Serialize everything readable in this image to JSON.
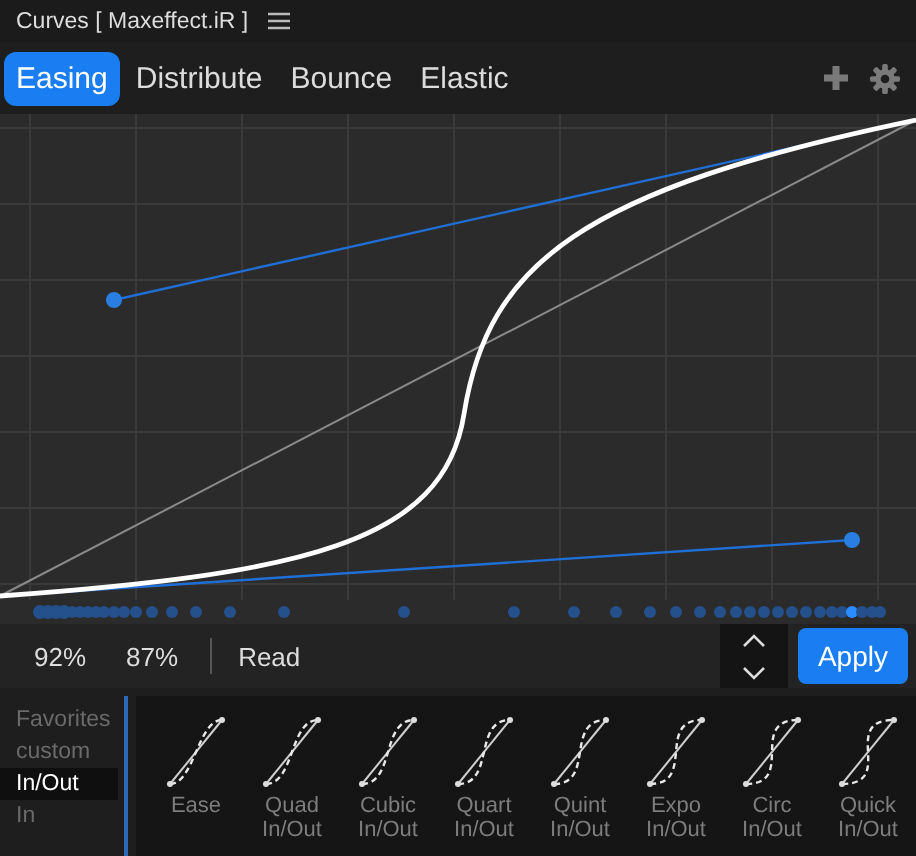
{
  "window": {
    "title": "Curves [ Maxeffect.iR ]"
  },
  "tabs": [
    {
      "label": "Easing",
      "selected": true
    },
    {
      "label": "Distribute",
      "selected": false
    },
    {
      "label": "Bounce",
      "selected": false
    },
    {
      "label": "Elastic",
      "selected": false
    }
  ],
  "readouts": [
    "92%",
    "87%"
  ],
  "read_button": "Read",
  "apply_button": "Apply",
  "categories": [
    {
      "label": "Favorites",
      "selected": false
    },
    {
      "label": "custom",
      "selected": false
    },
    {
      "label": "In/Out",
      "selected": true
    },
    {
      "label": "In",
      "selected": false
    }
  ],
  "presets": [
    {
      "label": "Ease"
    },
    {
      "label": "Quad In/Out"
    },
    {
      "label": "Cubic In/Out"
    },
    {
      "label": "Quart In/Out"
    },
    {
      "label": "Quint In/Out"
    },
    {
      "label": "Expo In/Out"
    },
    {
      "label": "Circ In/Out"
    },
    {
      "label": "Quick In/Out"
    }
  ]
}
